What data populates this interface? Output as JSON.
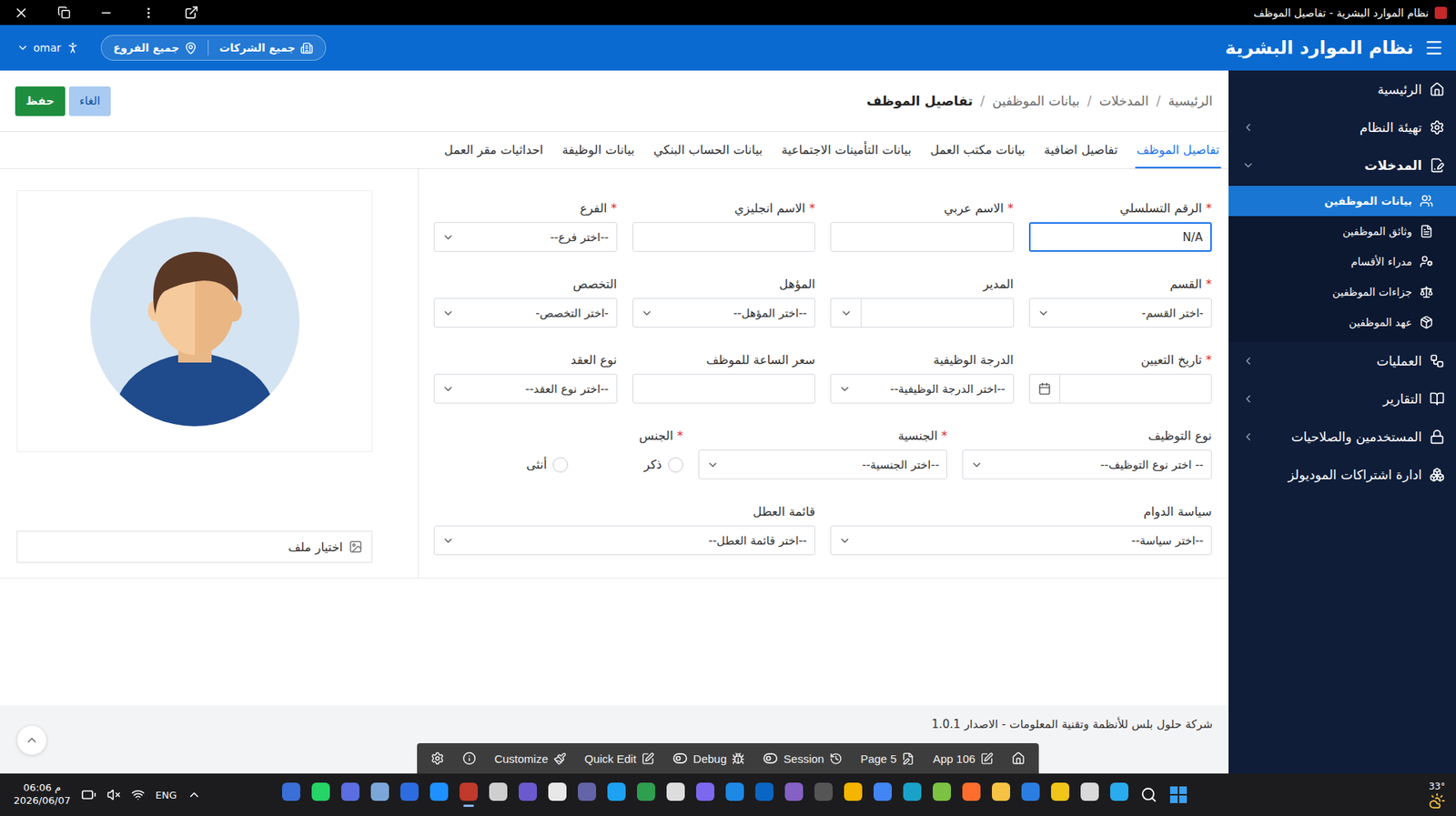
{
  "window": {
    "title": "نظام الموارد البشرية - تفاصيل الموظف"
  },
  "header": {
    "title": "نظام الموارد البشرية",
    "companies": "جميع الشركات",
    "branches": "جميع الفروع",
    "user": "omar"
  },
  "breadcrumb": {
    "separator": "/",
    "items": [
      {
        "label": "الرئيسية",
        "current": false
      },
      {
        "label": "المدخلات",
        "current": false
      },
      {
        "label": "بيانات الموظفين",
        "current": false
      },
      {
        "label": "تفاصيل الموظف",
        "current": true
      }
    ]
  },
  "actions": [
    {
      "label": "الغاء",
      "kind": "cancel"
    },
    {
      "label": "حفظ",
      "kind": "save"
    }
  ],
  "tabs": [
    {
      "label": "تفاصيل الموظف",
      "selected": true
    },
    {
      "label": "تفاصيل اضافية",
      "selected": false
    },
    {
      "label": "بيانات مكتب العمل",
      "selected": false
    },
    {
      "label": "بيانات التأمينات الاجتماعية",
      "selected": false
    },
    {
      "label": "بيانات الحساب البنكي",
      "selected": false
    },
    {
      "label": "بيانات الوظيفة",
      "selected": false
    },
    {
      "label": "احداثيات مقر العمل",
      "selected": false
    }
  ],
  "form": {
    "required_mark": "*",
    "rows": [
      [
        {
          "label": "الرقم التسلسلي",
          "required": true,
          "kind": "text",
          "value": "N/A",
          "focused": true
        },
        {
          "label": "الاسم عربي",
          "required": true,
          "kind": "text",
          "value": "",
          "focused": false
        },
        {
          "label": "الاسم انجليزي",
          "required": true,
          "kind": "text",
          "value": "",
          "focused": false
        },
        {
          "label": "الفرع",
          "required": true,
          "kind": "select",
          "placeholder": "--اختر فرع--"
        }
      ],
      [
        {
          "label": "القسم",
          "required": true,
          "kind": "select",
          "placeholder": "-اختر القسم-"
        },
        {
          "label": "المدير",
          "required": false,
          "kind": "lov",
          "value": ""
        },
        {
          "label": "المؤهل",
          "required": false,
          "kind": "select",
          "placeholder": "--اختر المؤهل--"
        },
        {
          "label": "التخصص",
          "required": false,
          "kind": "select",
          "placeholder": "-اختر التخصص-"
        }
      ],
      [
        {
          "label": "تاريخ التعيين",
          "required": true,
          "kind": "date",
          "value": ""
        },
        {
          "label": "الدرجة الوظيفية",
          "required": false,
          "kind": "select",
          "placeholder": "--اختر الدرجة الوظيفية--"
        },
        {
          "label": "سعر الساعة للموظف",
          "required": false,
          "kind": "text",
          "value": "",
          "focused": false
        },
        {
          "label": "نوع العقد",
          "required": false,
          "kind": "select",
          "placeholder": "--اختر نوع العقد--"
        }
      ],
      [
        {
          "label": "نوع التوظيف",
          "required": false,
          "kind": "select",
          "placeholder": "-- اختر نوع التوظيف--"
        },
        {
          "label": "الجنسية",
          "required": true,
          "kind": "select",
          "placeholder": "--اختر الجنسية--"
        },
        {
          "label": "الجنس",
          "required": true,
          "kind": "radio",
          "options": [
            {
              "label": "ذكر",
              "selected": false
            },
            {
              "label": "أنثى",
              "selected": false
            }
          ]
        }
      ],
      [
        {
          "label": "سياسة الدوام",
          "required": false,
          "kind": "select",
          "placeholder": "--اختر سياسة--"
        },
        {
          "label": "قائمة العطل",
          "required": false,
          "kind": "select",
          "placeholder": "--اختر قائمة العطل--"
        }
      ]
    ]
  },
  "photo": {
    "file_button": "اختيار ملف"
  },
  "sidebar": {
    "items": [
      {
        "label": "الرئيسية",
        "expandable": false,
        "expanded": false,
        "children": []
      },
      {
        "label": "تهيئة النظام",
        "expandable": true,
        "expanded": false,
        "children": []
      },
      {
        "label": "المدخلات",
        "expandable": true,
        "expanded": true,
        "children": [
          {
            "label": "بيانات الموظفين",
            "selected": true
          },
          {
            "label": "وثائق الموظفين",
            "selected": false
          },
          {
            "label": "مدراء الأقسام",
            "selected": false
          },
          {
            "label": "جزاءات الموظفين",
            "selected": false
          },
          {
            "label": "عهد الموظفين",
            "selected": false
          }
        ]
      },
      {
        "label": "العمليات",
        "expandable": true,
        "expanded": false,
        "children": []
      },
      {
        "label": "التقارير",
        "expandable": true,
        "expanded": false,
        "children": []
      },
      {
        "label": "المستخدمين والصلاحيات",
        "expandable": true,
        "expanded": false,
        "children": []
      },
      {
        "label": "ادارة اشتراكات الموديولز",
        "expandable": false,
        "expanded": false,
        "children": []
      }
    ]
  },
  "footer": {
    "text": "شركة حلول بلس للأنظمة وتقنية المعلومات - الاصدار 1.0.1"
  },
  "dev_toolbar": {
    "items": [
      {
        "label": "Customize",
        "kind": "button"
      },
      {
        "label": "Quick Edit",
        "kind": "button"
      },
      {
        "label": "Debug",
        "kind": "toggle",
        "on": false
      },
      {
        "label": "Session",
        "kind": "toggle",
        "on": false
      },
      {
        "label": "Page 5",
        "kind": "button"
      },
      {
        "label": "App 106",
        "kind": "button"
      }
    ]
  },
  "taskbar": {
    "time": "06:06 م",
    "date": "2026/06/07",
    "language": "ENG",
    "temperature": "33°",
    "apps": [
      {
        "color": "#3a6fd8",
        "active": false
      },
      {
        "color": "#25d366",
        "active": false
      },
      {
        "color": "#5b6ee1",
        "active": false
      },
      {
        "color": "#7aa7d8",
        "active": false
      },
      {
        "color": "#2d6cdf",
        "active": false
      },
      {
        "color": "#1e90ff",
        "active": false
      },
      {
        "color": "#c0392b",
        "active": true
      },
      {
        "color": "#cfcfcf",
        "active": false
      },
      {
        "color": "#6a5acd",
        "active": false
      },
      {
        "color": "#e8e8e8",
        "active": false
      },
      {
        "color": "#6264a7",
        "active": false
      },
      {
        "color": "#1da1f2",
        "active": false
      },
      {
        "color": "#2e9e4f",
        "active": false
      },
      {
        "color": "#dddddd",
        "active": false
      },
      {
        "color": "#7b68ee",
        "active": false
      },
      {
        "color": "#1e88e5",
        "active": false
      },
      {
        "color": "#0a66c2",
        "active": false
      },
      {
        "color": "#8661c5",
        "active": false
      },
      {
        "color": "#555555",
        "active": false
      },
      {
        "color": "#f4b400",
        "active": false
      },
      {
        "color": "#4285f4",
        "active": false
      },
      {
        "color": "#1aa1c7",
        "active": false
      },
      {
        "color": "#7cc142",
        "active": false
      },
      {
        "color": "#ff6d2d",
        "active": false
      },
      {
        "color": "#f6c244",
        "active": false
      },
      {
        "color": "#2a7de1",
        "active": false
      },
      {
        "color": "#f0c419",
        "active": false
      },
      {
        "color": "#d9d9d9",
        "active": false
      },
      {
        "color": "#2aabee",
        "active": false
      }
    ]
  }
}
